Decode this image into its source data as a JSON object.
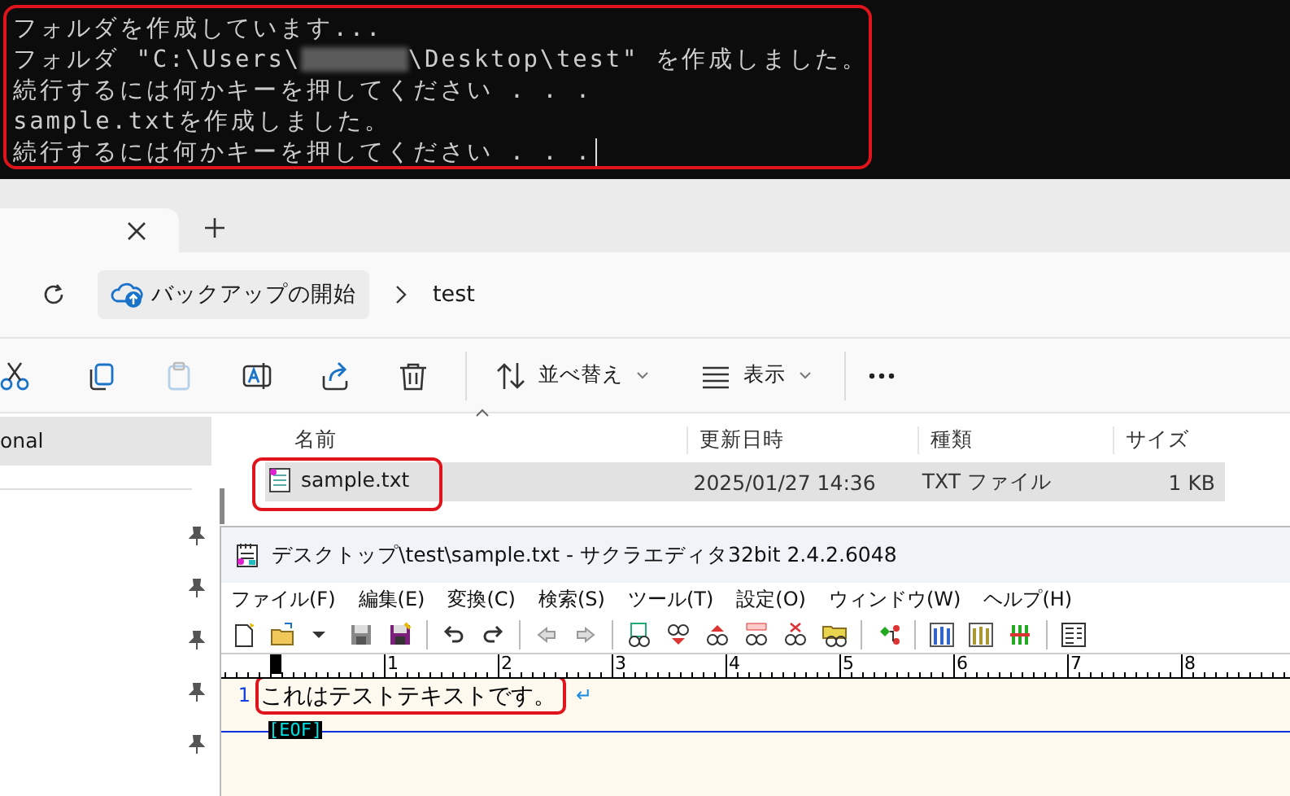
{
  "terminal": {
    "highlighted": true,
    "lines": [
      {
        "segments": [
          {
            "kind": "text",
            "text": "フォルダを作成しています..."
          }
        ]
      },
      {
        "segments": [
          {
            "kind": "text",
            "text": "フォルダ \"C:\\Users\\"
          },
          {
            "kind": "redacted"
          },
          {
            "kind": "text",
            "text": "\\Desktop\\test\" を作成しました。"
          }
        ]
      },
      {
        "segments": [
          {
            "kind": "text",
            "text": "続行するには何かキーを押してください . . ."
          }
        ]
      },
      {
        "segments": [
          {
            "kind": "text",
            "text": "sample.txtを作成しました。"
          }
        ]
      },
      {
        "segments": [
          {
            "kind": "text",
            "text": "続行するには何かキーを押してください . . ."
          }
        ],
        "cursor": true
      }
    ]
  },
  "explorer": {
    "breadcrumb": [
      "バックアップの開始",
      "test"
    ],
    "commands": [
      {
        "kind": "icon",
        "disabled": false
      },
      {
        "kind": "icon",
        "disabled": false
      },
      {
        "kind": "icon",
        "disabled": true
      },
      {
        "kind": "icon",
        "disabled": false
      },
      {
        "kind": "icon",
        "disabled": false
      },
      {
        "kind": "icon",
        "disabled": false
      },
      {
        "kind": "separator"
      },
      {
        "kind": "menu",
        "label": "並べ替え"
      },
      {
        "kind": "menu",
        "label": "表示"
      },
      {
        "kind": "separator"
      },
      {
        "kind": "icon",
        "disabled": false
      }
    ],
    "nav_items": [
      {
        "label": "onal",
        "selected": true
      }
    ],
    "columns": [
      "名前",
      "更新日時",
      "種類",
      "サイズ"
    ],
    "rows": [
      {
        "name": "sample.txt",
        "modified": "2025/01/27 14:36",
        "type": "TXT ファイル",
        "size": "1 KB",
        "selected": true,
        "highlighted": true
      }
    ]
  },
  "editor": {
    "title": "デスクトップ\\test\\sample.txt - サクラエディタ32bit 2.4.2.6048",
    "menu": [
      "ファイル(F)",
      "編集(E)",
      "変換(C)",
      "検索(S)",
      "ツール(T)",
      "設定(O)",
      "ウィンドウ(W)",
      "ヘルプ(H)"
    ],
    "ruler": [
      "1",
      "2",
      "3",
      "4",
      "5",
      "6",
      "7",
      "8"
    ],
    "lines": [
      {
        "number": "1",
        "text": "これはテストテキストです。",
        "newline": "↵",
        "highlighted": true
      }
    ],
    "eof": "[EOF]"
  }
}
